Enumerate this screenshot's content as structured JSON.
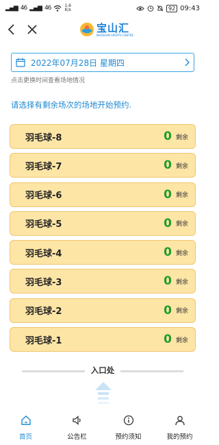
{
  "status_bar": {
    "signal_1": "46",
    "signal_2": "46",
    "speed_value": "1.6",
    "speed_unit": "K/s",
    "battery": "92",
    "time": "09:43"
  },
  "header": {
    "logo_text": "宝山汇",
    "logo_subtitle": "BAOSHAN SPORTS CENTRE"
  },
  "date_picker": {
    "value": "2022年07月28日 星期四",
    "hint": "点击更换时间查看场地情况"
  },
  "instruction": "请选择有剩余场次的场地开始预约.",
  "remaining_label": "剩余",
  "courts": [
    {
      "name": "羽毛球-8",
      "remaining": "0"
    },
    {
      "name": "羽毛球-7",
      "remaining": "0"
    },
    {
      "name": "羽毛球-6",
      "remaining": "0"
    },
    {
      "name": "羽毛球-5",
      "remaining": "0"
    },
    {
      "name": "羽毛球-4",
      "remaining": "0"
    },
    {
      "name": "羽毛球-3",
      "remaining": "0"
    },
    {
      "name": "羽毛球-2",
      "remaining": "0"
    },
    {
      "name": "羽毛球-1",
      "remaining": "0"
    }
  ],
  "entrance_label": "入口处",
  "tabs": [
    {
      "label": "首页",
      "icon": "home-icon",
      "active": true
    },
    {
      "label": "公告栏",
      "icon": "speaker-icon",
      "active": false
    },
    {
      "label": "预约须知",
      "icon": "info-icon",
      "active": false
    },
    {
      "label": "我的预约",
      "icon": "user-icon",
      "active": false
    }
  ],
  "colors": {
    "accent": "#1e88d2",
    "court_bg": "#fde5a6",
    "court_border": "#efc56f",
    "count_green": "#1d9c2e"
  }
}
